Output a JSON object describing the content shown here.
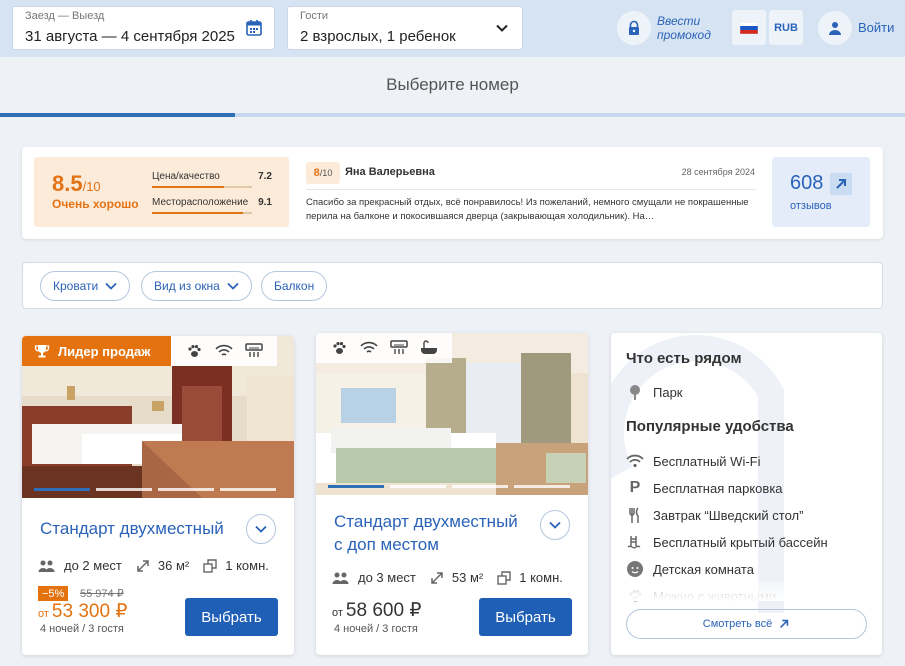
{
  "search": {
    "dates_label": "Заезд — Выезд",
    "dates_value": "31 августа — 4 сентября 2025",
    "guests_label": "Гости",
    "guests_value": "2 взрослых, 1 ребенок"
  },
  "header": {
    "promo_line1": "Ввести",
    "promo_line2": "промокод",
    "currency": "RUB",
    "login": "Войти"
  },
  "page_title": "Выберите номер",
  "booking_progress": 0.26,
  "reviews": {
    "score": "8.5",
    "score_max": "/10",
    "score_label": "Очень хорошо",
    "metrics": [
      {
        "label": "Цена/качество",
        "value": "7.2",
        "fraction": 0.72
      },
      {
        "label": "Месторасположение",
        "value": "9.1",
        "fraction": 0.91
      }
    ],
    "latest": {
      "rating": "8",
      "rating_max": "/10",
      "author": "Яна Валерьевна",
      "date": "28 сентября 2024",
      "text": "Спасибо за прекрасный отдых, всё понравилось! Из пожеланий, немного смущали не покрашенные перила на балконе и покосившаяся дверца (закрывающая холодильник). На…"
    },
    "count": "608",
    "count_label": "отзывов"
  },
  "filters": [
    "Кровати",
    "Вид из окна",
    "Балкон"
  ],
  "rooms": [
    {
      "badge": "Лидер продаж",
      "name": "Стандарт двухместный",
      "guests": "до 2 мест",
      "area": "36 м²",
      "rooms": "1 комн.",
      "discount": "−5%",
      "old_price": "55 974 ₽",
      "price_prefix": "от",
      "price": "53 300 ₽",
      "nights": "4 ночей / 3 гостя",
      "button": "Выбрать"
    },
    {
      "name_line1": "Стандарт двухместный",
      "name_line2": "с доп местом",
      "guests": "до 3 мест",
      "area": "53 м²",
      "rooms": "1 комн.",
      "price_prefix": "от",
      "price": "58 600 ₽",
      "nights": "4 ночей / 3 гостя",
      "button": "Выбрать"
    }
  ],
  "nearby": {
    "title": "Что есть рядом",
    "places": [
      {
        "label": "Парк",
        "icon": "tree-icon"
      }
    ],
    "amenities_title": "Популярные удобства",
    "amenities": [
      {
        "label": "Бесплатный Wi-Fi",
        "icon": "wifi-icon"
      },
      {
        "label": "Бесплатная парковка",
        "icon": "parking-icon"
      },
      {
        "label": "Завтрак “Шведский стол”",
        "icon": "cutlery-icon"
      },
      {
        "label": "Бесплатный крытый бассейн",
        "icon": "pool-icon"
      },
      {
        "label": "Детская комната",
        "icon": "child-icon"
      },
      {
        "label": "Можно с животными",
        "icon": "paw-icon"
      }
    ],
    "see_all": "Смотреть всё"
  },
  "colors": {
    "accent": "#2a63b8",
    "orange": "#e4730f",
    "topbar": "#d6e3f3",
    "button": "#1f5fb5"
  }
}
